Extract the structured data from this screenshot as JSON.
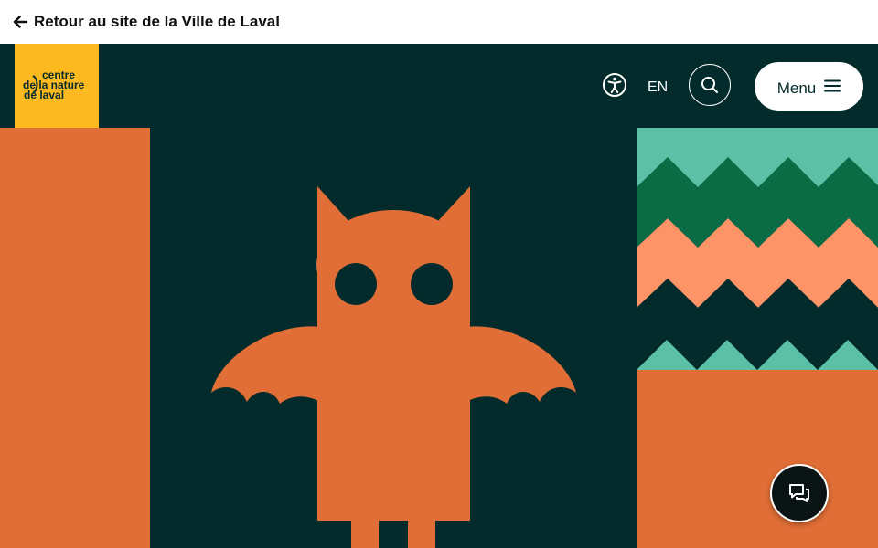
{
  "topbar": {
    "back_label": "Retour au site de la Ville de Laval",
    "back_icon": "arrow-left-icon"
  },
  "header": {
    "logo_lines": [
      "centre",
      "de la nature",
      "de laval"
    ],
    "accessibility_icon": "accessibility-icon",
    "lang_label": "EN",
    "search_icon": "search-icon",
    "menu_label": "Menu",
    "menu_icon": "hamburger-icon"
  },
  "hero": {
    "illustration": "bat-illustration"
  },
  "chat": {
    "icon": "chat-bubbles-icon"
  },
  "colors": {
    "header_bg": "#032b2b",
    "logo_bg": "#fcb920",
    "orange": "#e06e36",
    "dark_teal": "#032b2b",
    "mint": "#5bc0a5",
    "green": "#0a6b45",
    "salmon": "#fc9468"
  }
}
